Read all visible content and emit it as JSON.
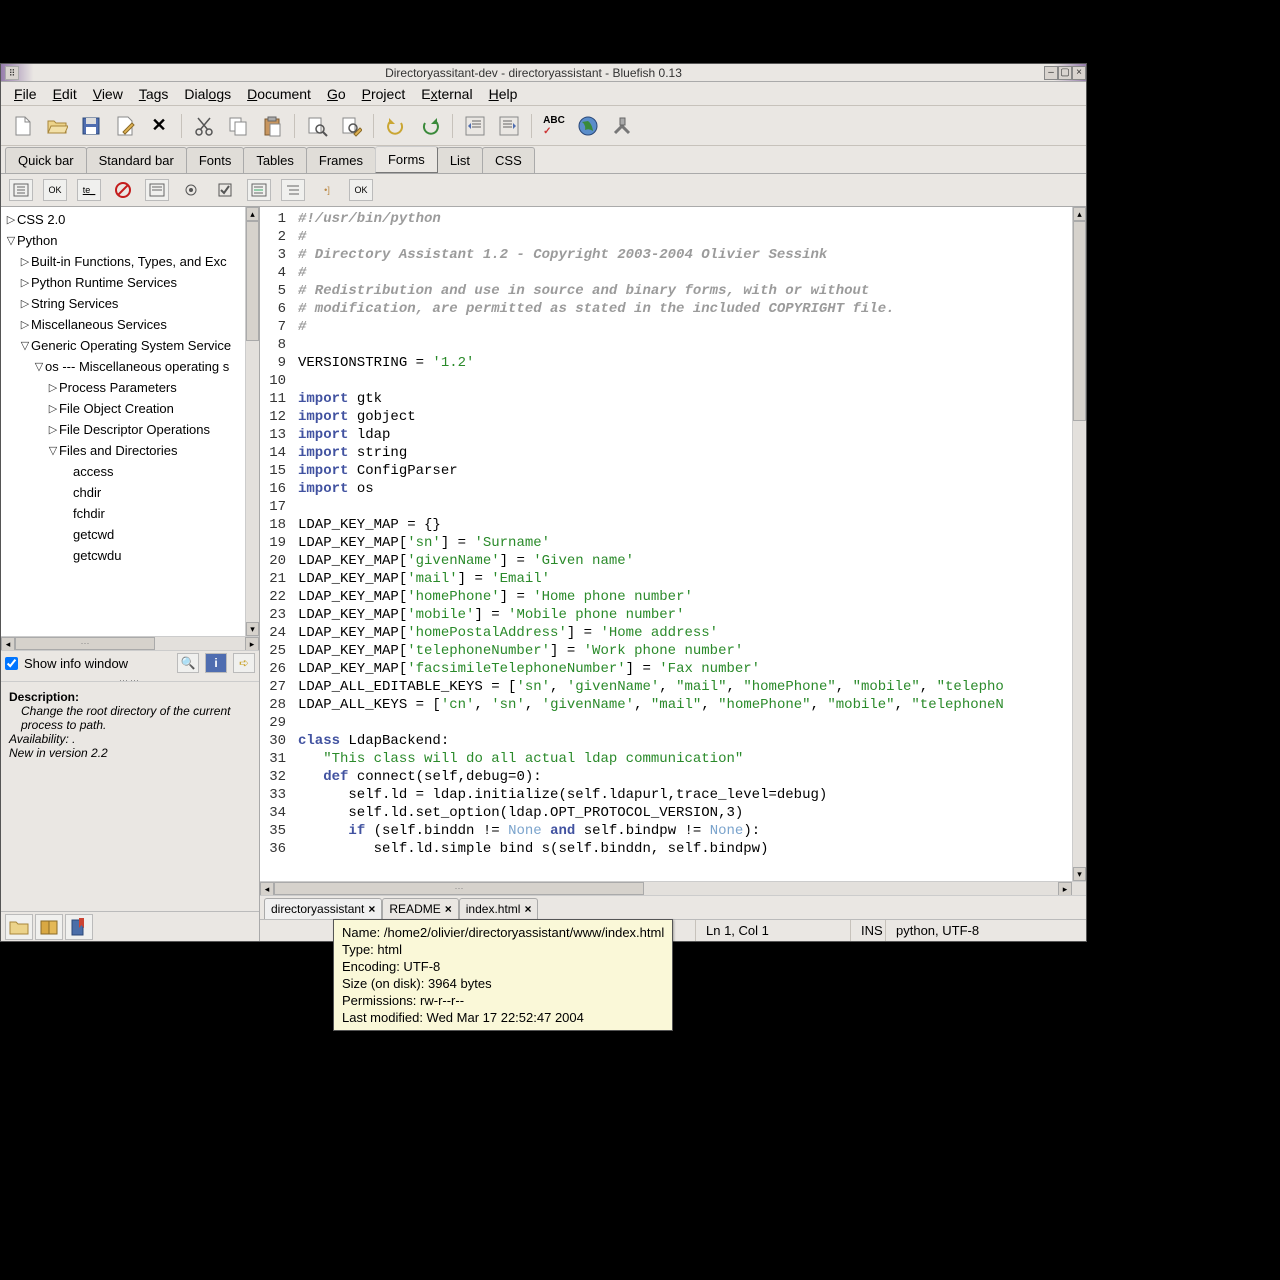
{
  "titlebar": {
    "title": "Directoryassitant-dev - directoryassistant - Bluefish 0.13"
  },
  "menubar": {
    "items": [
      "File",
      "Edit",
      "View",
      "Tags",
      "Dialogs",
      "Document",
      "Go",
      "Project",
      "External",
      "Help"
    ],
    "accel_index": [
      0,
      0,
      0,
      0,
      4,
      0,
      0,
      0,
      1,
      0
    ]
  },
  "toolbar": {
    "tools": [
      "new-file",
      "open-file",
      "save-file",
      "edit-file",
      "close",
      "cut",
      "copy",
      "paste",
      "find",
      "find-replace",
      "undo",
      "redo",
      "outdent",
      "indent",
      "spellcheck",
      "browser",
      "preferences"
    ]
  },
  "tabbar": {
    "tabs": [
      "Quick bar",
      "Standard bar",
      "Fonts",
      "Tables",
      "Frames",
      "Forms",
      "List",
      "CSS"
    ],
    "active": "Forms"
  },
  "formbar": {
    "tools": [
      "form",
      "ok-button",
      "text-input",
      "no-entry",
      "textarea",
      "radio",
      "checkbox",
      "select",
      "optgroup",
      "option",
      "ok-btn"
    ]
  },
  "tree": [
    {
      "depth": 0,
      "arrow": "▷",
      "label": "CSS 2.0"
    },
    {
      "depth": 0,
      "arrow": "▽",
      "label": "Python"
    },
    {
      "depth": 1,
      "arrow": "▷",
      "label": "Built-in Functions, Types, and Exc"
    },
    {
      "depth": 1,
      "arrow": "▷",
      "label": "Python Runtime Services"
    },
    {
      "depth": 1,
      "arrow": "▷",
      "label": "String Services"
    },
    {
      "depth": 1,
      "arrow": "▷",
      "label": "Miscellaneous Services"
    },
    {
      "depth": 1,
      "arrow": "▽",
      "label": "Generic Operating System Service"
    },
    {
      "depth": 2,
      "arrow": "▽",
      "label": "os --- Miscellaneous operating s"
    },
    {
      "depth": 3,
      "arrow": "▷",
      "label": "Process Parameters"
    },
    {
      "depth": 3,
      "arrow": "▷",
      "label": "File Object Creation"
    },
    {
      "depth": 3,
      "arrow": "▷",
      "label": "File Descriptor Operations"
    },
    {
      "depth": 3,
      "arrow": "▽",
      "label": "Files and Directories"
    },
    {
      "depth": 4,
      "arrow": "",
      "label": "access"
    },
    {
      "depth": 4,
      "arrow": "",
      "label": "chdir"
    },
    {
      "depth": 4,
      "arrow": "",
      "label": "fchdir"
    },
    {
      "depth": 4,
      "arrow": "",
      "label": "getcwd"
    },
    {
      "depth": 4,
      "arrow": "",
      "label": "getcwdu"
    }
  ],
  "show_info": {
    "label": "Show info window",
    "checked": true
  },
  "description": {
    "heading": "Description:",
    "change": "Change the root directory of the current process to path.",
    "availability": "Availability: .",
    "newin": "New in version 2.2"
  },
  "doctabs": [
    {
      "label": "directoryassistant",
      "active": true
    },
    {
      "label": "README",
      "active": false
    },
    {
      "label": "index.html",
      "active": false
    }
  ],
  "statusbar": {
    "position": "Ln 1, Col 1",
    "mode": "INS",
    "encoding": "python, UTF-8"
  },
  "tooltip": {
    "name": "Name: /home2/olivier/directoryassistant/www/index.html",
    "type": "Type: html",
    "encoding": "Encoding: UTF-8",
    "size": "Size (on disk): 3964 bytes",
    "permissions": "Permissions: rw-r--r--",
    "modified": "Last modified: Wed Mar 17 22:52:47 2004"
  },
  "code": [
    {
      "n": 1,
      "tokens": [
        [
          "cmt",
          "#!/usr/bin/python"
        ]
      ]
    },
    {
      "n": 2,
      "tokens": [
        [
          "cmt",
          "#"
        ]
      ]
    },
    {
      "n": 3,
      "tokens": [
        [
          "cmt",
          "# Directory Assistant 1.2 - Copyright 2003-2004 Olivier Sessink"
        ]
      ]
    },
    {
      "n": 4,
      "tokens": [
        [
          "cmt",
          "#"
        ]
      ]
    },
    {
      "n": 5,
      "tokens": [
        [
          "cmt",
          "# Redistribution and use in source and binary forms, with or without"
        ]
      ]
    },
    {
      "n": 6,
      "tokens": [
        [
          "cmt",
          "# modification, are permitted as stated in the included COPYRIGHT file."
        ]
      ]
    },
    {
      "n": 7,
      "tokens": [
        [
          "cmt",
          "#"
        ]
      ]
    },
    {
      "n": 8,
      "tokens": []
    },
    {
      "n": 9,
      "tokens": [
        [
          "name",
          "VERSIONSTRING = "
        ],
        [
          "str",
          "'1.2'"
        ]
      ]
    },
    {
      "n": 10,
      "tokens": []
    },
    {
      "n": 11,
      "tokens": [
        [
          "kw",
          "import "
        ],
        [
          "name",
          "gtk"
        ]
      ]
    },
    {
      "n": 12,
      "tokens": [
        [
          "kw",
          "import "
        ],
        [
          "name",
          "gobject"
        ]
      ]
    },
    {
      "n": 13,
      "tokens": [
        [
          "kw",
          "import "
        ],
        [
          "name",
          "ldap"
        ]
      ]
    },
    {
      "n": 14,
      "tokens": [
        [
          "kw",
          "import "
        ],
        [
          "name",
          "string"
        ]
      ]
    },
    {
      "n": 15,
      "tokens": [
        [
          "kw",
          "import "
        ],
        [
          "name",
          "ConfigParser"
        ]
      ]
    },
    {
      "n": 16,
      "tokens": [
        [
          "kw",
          "import "
        ],
        [
          "name",
          "os"
        ]
      ]
    },
    {
      "n": 17,
      "tokens": []
    },
    {
      "n": 18,
      "tokens": [
        [
          "name",
          "LDAP_KEY_MAP = {}"
        ]
      ]
    },
    {
      "n": 19,
      "tokens": [
        [
          "name",
          "LDAP_KEY_MAP["
        ],
        [
          "str",
          "'sn'"
        ],
        [
          "name",
          "] = "
        ],
        [
          "str",
          "'Surname'"
        ]
      ]
    },
    {
      "n": 20,
      "tokens": [
        [
          "name",
          "LDAP_KEY_MAP["
        ],
        [
          "str",
          "'givenName'"
        ],
        [
          "name",
          "] = "
        ],
        [
          "str",
          "'Given name'"
        ]
      ]
    },
    {
      "n": 21,
      "tokens": [
        [
          "name",
          "LDAP_KEY_MAP["
        ],
        [
          "str",
          "'mail'"
        ],
        [
          "name",
          "] = "
        ],
        [
          "str",
          "'Email'"
        ]
      ]
    },
    {
      "n": 22,
      "tokens": [
        [
          "name",
          "LDAP_KEY_MAP["
        ],
        [
          "str",
          "'homePhone'"
        ],
        [
          "name",
          "] = "
        ],
        [
          "str",
          "'Home phone number'"
        ]
      ]
    },
    {
      "n": 23,
      "tokens": [
        [
          "name",
          "LDAP_KEY_MAP["
        ],
        [
          "str",
          "'mobile'"
        ],
        [
          "name",
          "] = "
        ],
        [
          "str",
          "'Mobile phone number'"
        ]
      ]
    },
    {
      "n": 24,
      "tokens": [
        [
          "name",
          "LDAP_KEY_MAP["
        ],
        [
          "str",
          "'homePostalAddress'"
        ],
        [
          "name",
          "] = "
        ],
        [
          "str",
          "'Home address'"
        ]
      ]
    },
    {
      "n": 25,
      "tokens": [
        [
          "name",
          "LDAP_KEY_MAP["
        ],
        [
          "str",
          "'telephoneNumber'"
        ],
        [
          "name",
          "] = "
        ],
        [
          "str",
          "'Work phone number'"
        ]
      ]
    },
    {
      "n": 26,
      "tokens": [
        [
          "name",
          "LDAP_KEY_MAP["
        ],
        [
          "str",
          "'facsimileTelephoneNumber'"
        ],
        [
          "name",
          "] = "
        ],
        [
          "str",
          "'Fax number'"
        ]
      ]
    },
    {
      "n": 27,
      "tokens": [
        [
          "name",
          "LDAP_ALL_EDITABLE_KEYS = ["
        ],
        [
          "str",
          "'sn'"
        ],
        [
          "name",
          ", "
        ],
        [
          "str",
          "'givenName'"
        ],
        [
          "name",
          ", "
        ],
        [
          "str",
          "\"mail\""
        ],
        [
          "name",
          ", "
        ],
        [
          "str",
          "\"homePhone\""
        ],
        [
          "name",
          ", "
        ],
        [
          "str",
          "\"mobile\""
        ],
        [
          "name",
          ", "
        ],
        [
          "str",
          "\"telepho"
        ]
      ]
    },
    {
      "n": 28,
      "tokens": [
        [
          "name",
          "LDAP_ALL_KEYS = ["
        ],
        [
          "str",
          "'cn'"
        ],
        [
          "name",
          ", "
        ],
        [
          "str",
          "'sn'"
        ],
        [
          "name",
          ", "
        ],
        [
          "str",
          "'givenName'"
        ],
        [
          "name",
          ", "
        ],
        [
          "str",
          "\"mail\""
        ],
        [
          "name",
          ", "
        ],
        [
          "str",
          "\"homePhone\""
        ],
        [
          "name",
          ", "
        ],
        [
          "str",
          "\"mobile\""
        ],
        [
          "name",
          ", "
        ],
        [
          "str",
          "\"telephoneN"
        ]
      ]
    },
    {
      "n": 29,
      "tokens": []
    },
    {
      "n": 30,
      "tokens": [
        [
          "kw",
          "class "
        ],
        [
          "name",
          "LdapBackend:"
        ]
      ]
    },
    {
      "n": 31,
      "tokens": [
        [
          "name",
          "   "
        ],
        [
          "str",
          "\"This class will do all actual ldap communication\""
        ]
      ]
    },
    {
      "n": 32,
      "tokens": [
        [
          "name",
          "   "
        ],
        [
          "kw",
          "def "
        ],
        [
          "name",
          "connect(self,debug=0):"
        ]
      ]
    },
    {
      "n": 33,
      "tokens": [
        [
          "name",
          "      self.ld = ldap.initialize(self.ldapurl,trace_level=debug)"
        ]
      ]
    },
    {
      "n": 34,
      "tokens": [
        [
          "name",
          "      self.ld.set_option(ldap.OPT_PROTOCOL_VERSION,3)"
        ]
      ]
    },
    {
      "n": 35,
      "tokens": [
        [
          "name",
          "      "
        ],
        [
          "kw",
          "if "
        ],
        [
          "name",
          "(self.binddn != "
        ],
        [
          "const",
          "None"
        ],
        [
          "name",
          " "
        ],
        [
          "kw",
          "and "
        ],
        [
          "name",
          "self.bindpw != "
        ],
        [
          "const",
          "None"
        ],
        [
          "name",
          "):"
        ]
      ]
    },
    {
      "n": 36,
      "tokens": [
        [
          "name",
          "         self.ld.simple bind s(self.binddn, self.bindpw)"
        ]
      ]
    }
  ]
}
